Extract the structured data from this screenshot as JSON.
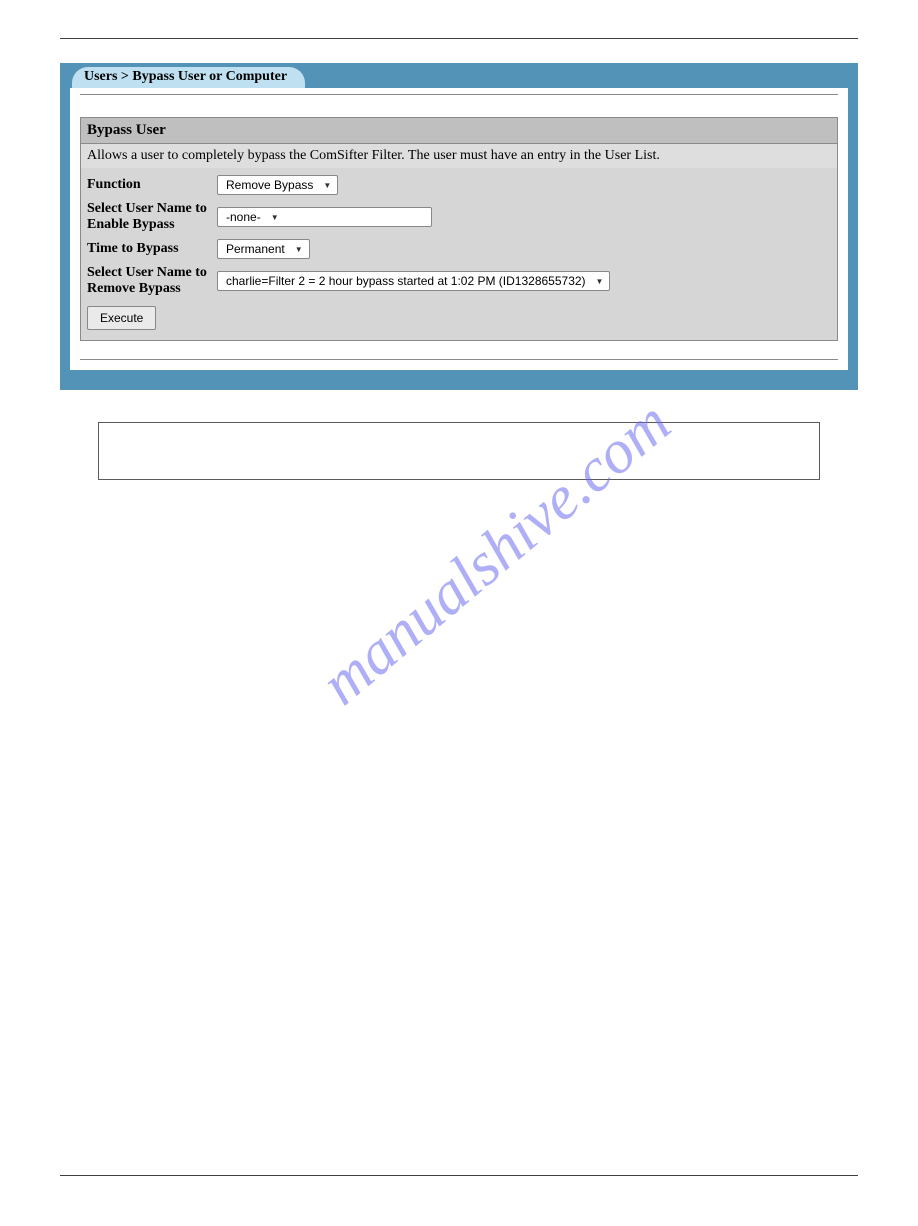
{
  "tab_label": "Users > Bypass User or Computer",
  "section": {
    "title": "Bypass User",
    "description": "Allows a user to completely bypass the ComSifter Filter. The user must have an entry in the User List."
  },
  "rows": {
    "function_label": "Function",
    "function_value": "Remove Bypass",
    "enable_user_label": "Select User Name to Enable Bypass",
    "enable_user_value": "-none-",
    "time_label": "Time to Bypass",
    "time_value": "Permanent",
    "remove_user_label": "Select User Name to Remove Bypass",
    "remove_user_value": "charlie=Filter 2 = 2 hour bypass started at 1:02 PM (ID1328655732)"
  },
  "button": {
    "execute": "Execute"
  },
  "watermark_text": "manualshive.com"
}
